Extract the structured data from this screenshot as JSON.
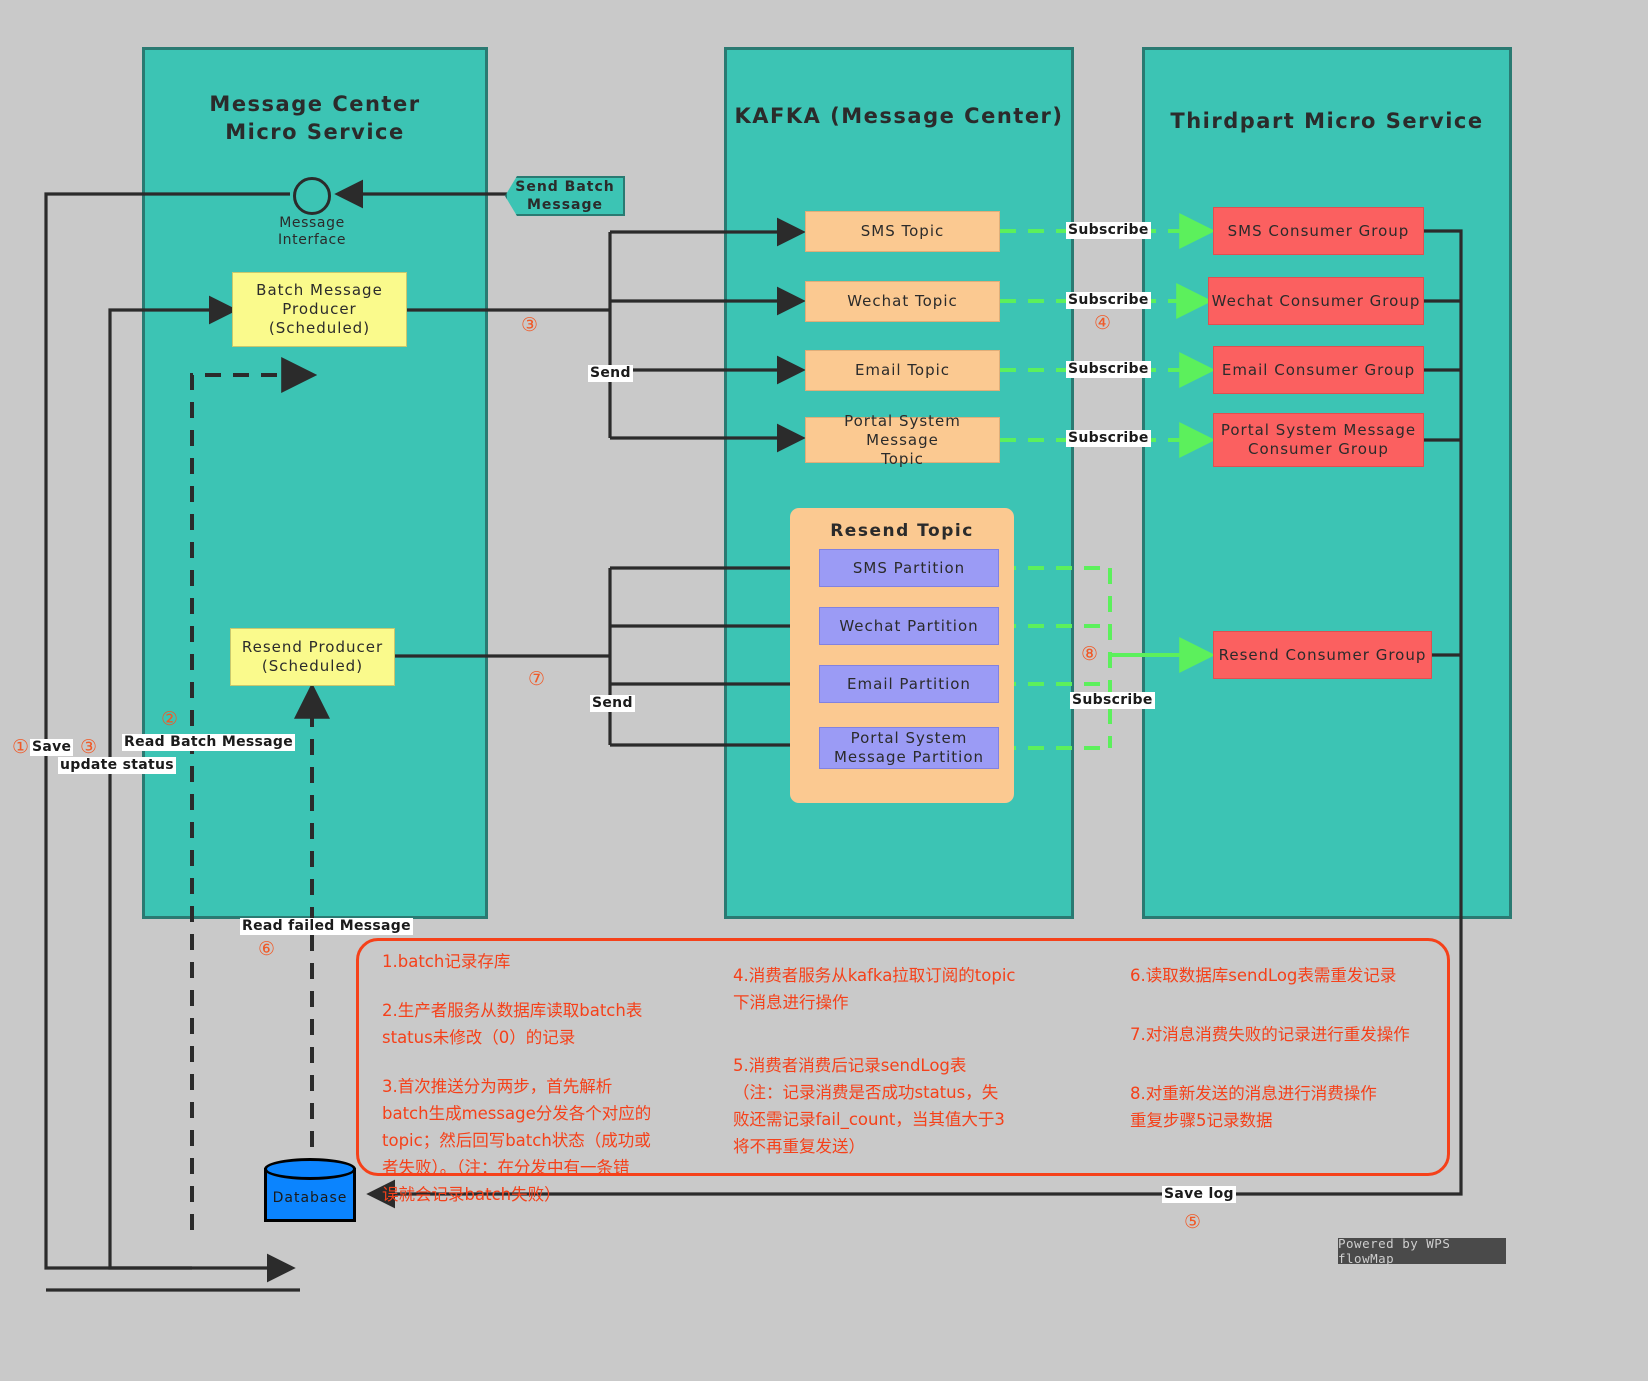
{
  "lanes": [
    {
      "title": "Message Center Micro Service"
    },
    {
      "title": "KAFKA (Message Center)"
    },
    {
      "title": "Thirdpart Micro Service"
    }
  ],
  "message_center": {
    "interface_label": "Message\nInterface",
    "interface_label_line1": "Message",
    "interface_label_line2": "Interface",
    "batch_producer": "Batch Message\nProducer\n(Scheduled)",
    "resend_producer": "Resend Producer\n(Scheduled)"
  },
  "entry": {
    "send_batch_message": "Send Batch\nMessage"
  },
  "kafka": {
    "topics": [
      {
        "label": "SMS Topic"
      },
      {
        "label": "Wechat Topic"
      },
      {
        "label": "Email Topic"
      },
      {
        "label": "Portal System Message\nTopic"
      }
    ],
    "resend_topic_title": "Resend Topic",
    "partitions": [
      {
        "label": "SMS Partition"
      },
      {
        "label": "Wechat Partition"
      },
      {
        "label": "Email Partition"
      },
      {
        "label": "Portal System\nMessage Partition"
      }
    ]
  },
  "thirdpart": {
    "consumer_groups": [
      {
        "label": "SMS Consumer Group"
      },
      {
        "label": "Wechat Consumer Group"
      },
      {
        "label": "Email Consumer Group"
      },
      {
        "label": "Portal System Message\nConsumer Group"
      }
    ],
    "resend_consumer_group": "Resend Consumer Group"
  },
  "edge_labels": {
    "subscribe": "Subscribe",
    "send": "Send",
    "save": "Save",
    "update_status": "update status",
    "read_batch_message": "Read Batch Message",
    "read_failed_message": "Read failed Message",
    "save_log": "Save log"
  },
  "steps": {
    "s1": "①",
    "s2": "②",
    "s3": "③",
    "s3b": "③",
    "s4": "④",
    "s5": "⑤",
    "s6": "⑥",
    "s7": "⑦",
    "s8": "⑧"
  },
  "database": {
    "label": "Database"
  },
  "notes": {
    "col1": [
      "1.batch记录存库",
      "2.生产者服务从数据库读取batch表\nstatus未修改（0）的记录",
      "3.首次推送分为两步，首先解析\nbatch生成message分发各个对应的\ntopic；然后回写batch状态（成功或\n者失败）。（注：在分发中有一条错\n误就会记录batch失败）"
    ],
    "col2": [
      "4.消费者服务从kafka拉取订阅的topic\n下消息进行操作",
      "5.消费者消费后记录sendLog表\n（注：记录消费是否成功status，失\n败还需记录fail_count，当其值大于3\n将不再重复发送）"
    ],
    "col3": [
      "6.读取数据库sendLog表需重发记录",
      "7.对消息消费失败的记录进行重发操作",
      "8.对重新发送的消息进行消费操作\n重复步骤5记录数据"
    ]
  },
  "watermark": {
    "text": "Powered by WPS flowMap"
  },
  "colors": {
    "lane": "#3cc4b4",
    "topic": "#fbc991",
    "consumer": "#fb6060",
    "partition": "#9b9bf5",
    "producer": "#fafa8c",
    "note": "#f5411a",
    "green_arrow": "#5cf05c",
    "db": "#0b84fe",
    "background": "#c9c9c9"
  }
}
